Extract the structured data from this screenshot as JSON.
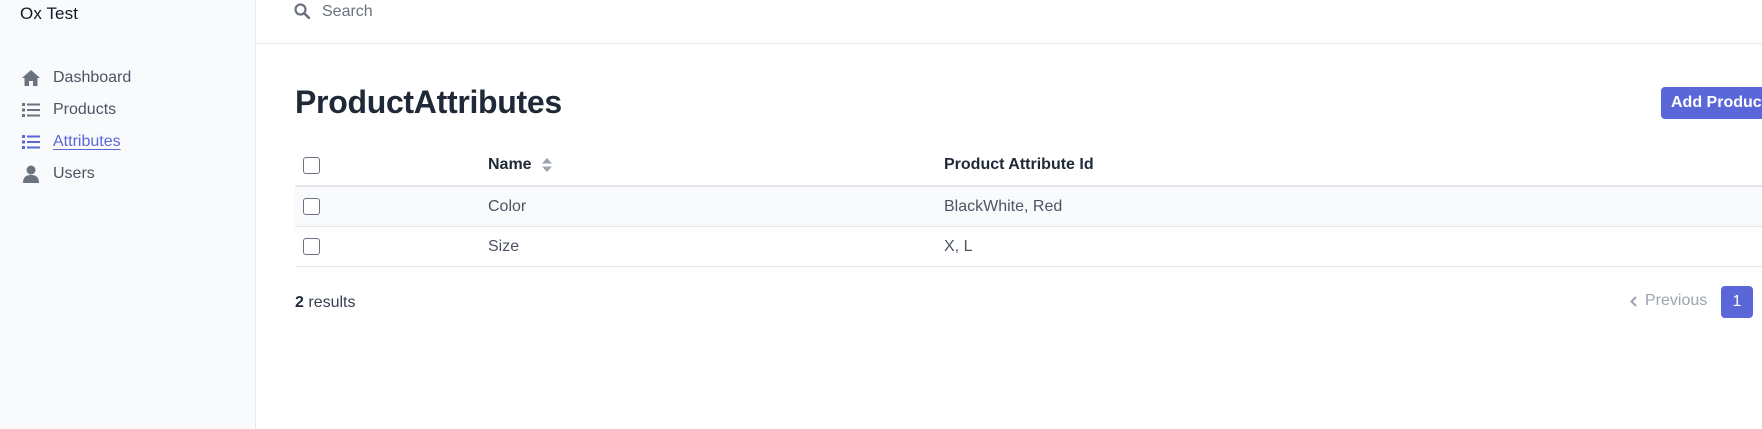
{
  "app": {
    "title": "Ox Test"
  },
  "sidebar": {
    "items": [
      {
        "label": "Dashboard",
        "icon": "home-icon",
        "active": false
      },
      {
        "label": "Products",
        "icon": "list-icon",
        "active": false
      },
      {
        "label": "Attributes",
        "icon": "list-icon",
        "active": true
      },
      {
        "label": "Users",
        "icon": "user-icon",
        "active": false
      }
    ]
  },
  "search": {
    "placeholder": "Search",
    "value": ""
  },
  "main": {
    "title": "ProductAttributes",
    "add_button_label": "Add ProductAttribute"
  },
  "table": {
    "columns": [
      "Name",
      "Product Attribute Id"
    ],
    "rows": [
      {
        "name": "Color",
        "product_attribute_id": "BlackWhite, Red"
      },
      {
        "name": "Size",
        "product_attribute_id": "X, L"
      }
    ]
  },
  "footer": {
    "results_count": "2",
    "results_label": "results",
    "previous_label": "Previous",
    "current_page": "1"
  },
  "colors": {
    "accent": "#5a67d8",
    "sidebar_bg": "#f9fafb",
    "border": "#e5e7eb",
    "text": "#374151"
  }
}
